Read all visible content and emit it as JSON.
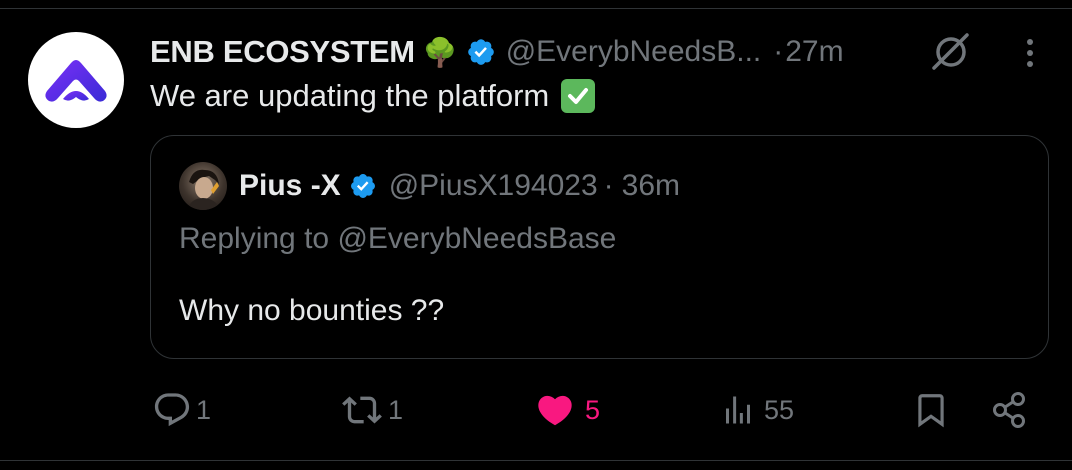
{
  "tweet": {
    "author": {
      "display_name": "ENB ECOSYSTEM",
      "name_emoji": "🌳",
      "verified": true,
      "handle": "@EverybNeedsB...",
      "avatar_icon": "enb-logo-icon"
    },
    "separator": "·",
    "time": "27m",
    "text": "We are updating the platform",
    "text_emoji": "check-mark-button-icon"
  },
  "quote": {
    "author": {
      "display_name": "Pius -X",
      "verified": true,
      "handle": "@PiusX194023"
    },
    "separator": "·",
    "time": "36m",
    "replying_prefix": "Replying to",
    "replying_to": "@EverybNeedsBase",
    "text": "Why no bounties ??"
  },
  "actions": {
    "replies": "1",
    "reposts": "1",
    "likes": "5",
    "views": "55"
  },
  "colors": {
    "background": "#000000",
    "primary_text": "#e7e9ea",
    "secondary_text": "#71767b",
    "verified_blue": "#1d9bf0",
    "like_pink": "#f91880",
    "border": "#2f3336"
  }
}
